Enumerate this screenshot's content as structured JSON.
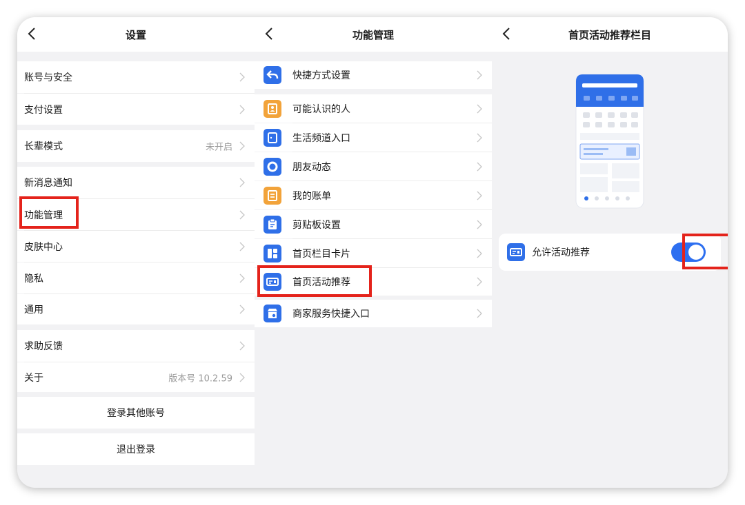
{
  "panel1": {
    "title": "设置",
    "items": [
      {
        "label": "账号与安全",
        "value": ""
      },
      {
        "label": "支付设置",
        "value": ""
      },
      {
        "label": "长辈模式",
        "value": "未开启"
      },
      {
        "label": "新消息通知",
        "value": ""
      },
      {
        "label": "功能管理",
        "value": ""
      },
      {
        "label": "皮肤中心",
        "value": ""
      },
      {
        "label": "隐私",
        "value": ""
      },
      {
        "label": "通用",
        "value": ""
      },
      {
        "label": "求助反馈",
        "value": ""
      },
      {
        "label": "关于",
        "value": "版本号 10.2.59"
      }
    ],
    "login_other": "登录其他账号",
    "logout": "退出登录"
  },
  "panel2": {
    "title": "功能管理",
    "items": [
      {
        "label": "快捷方式设置",
        "icon": "back-arrow-icon",
        "color": "#2f6fe8"
      },
      {
        "label": "可能认识的人",
        "icon": "contact-card-icon",
        "color": "#f2a33a"
      },
      {
        "label": "生活频道入口",
        "icon": "door-icon",
        "color": "#2f6fe8"
      },
      {
        "label": "朋友动态",
        "icon": "ring-icon",
        "color": "#2f6fe8"
      },
      {
        "label": "我的账单",
        "icon": "bill-icon",
        "color": "#f2a33a"
      },
      {
        "label": "剪贴板设置",
        "icon": "clipboard-icon",
        "color": "#2f6fe8"
      },
      {
        "label": "首页栏目卡片",
        "icon": "column-card-icon",
        "color": "#2f6fe8"
      },
      {
        "label": "首页活动推荐",
        "icon": "banner-icon",
        "color": "#2f6fe8"
      },
      {
        "label": "商家服务快捷入口",
        "icon": "shop-icon",
        "color": "#2f6fe8"
      }
    ]
  },
  "panel3": {
    "title": "首页活动推荐栏目",
    "toggle_label": "允许活动推荐",
    "toggle_on": true,
    "accent": "#2d6ff0"
  },
  "highlight_color": "#e4231b"
}
